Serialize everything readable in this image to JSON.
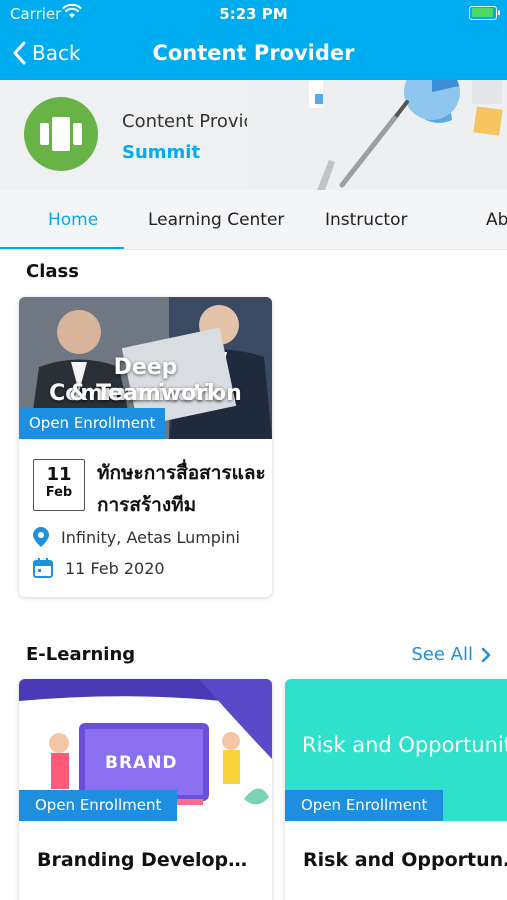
{
  "status": {
    "carrier": "Carrier",
    "time": "5:23 PM"
  },
  "nav": {
    "back_label": "Back",
    "title": "Content Provider"
  },
  "provider": {
    "label": "Content Provider",
    "name": "Summit"
  },
  "tabs": [
    {
      "label": "Home",
      "active": true
    },
    {
      "label": "Learning Center",
      "active": false
    },
    {
      "label": "Instructor",
      "active": false
    },
    {
      "label": "Ab",
      "active": false
    }
  ],
  "class_section": {
    "title": "Class",
    "card": {
      "image_text_line1": "Deep Communication",
      "image_text_line2": "& Teamwork",
      "badge": "Open Enrollment",
      "day": "11",
      "month": "Feb",
      "title": "ทักษะการสื่อสารและการสร้างทีม",
      "location": "Infinity, Aetas Lumpini",
      "date": "11 Feb 2020"
    }
  },
  "elearning_section": {
    "title": "E-Learning",
    "see_all": "See All",
    "cards": [
      {
        "image_text": "BRAND",
        "badge": "Open Enrollment",
        "title": "Branding Development"
      },
      {
        "image_text": "Risk and Opportunities",
        "badge": "Open Enrollment",
        "title": "Risk and Opportunities"
      }
    ]
  },
  "colors": {
    "primary": "#00ACF0",
    "badge": "#1E8EE0",
    "logo_green": "#68B346",
    "teal": "#2FE0CC"
  }
}
